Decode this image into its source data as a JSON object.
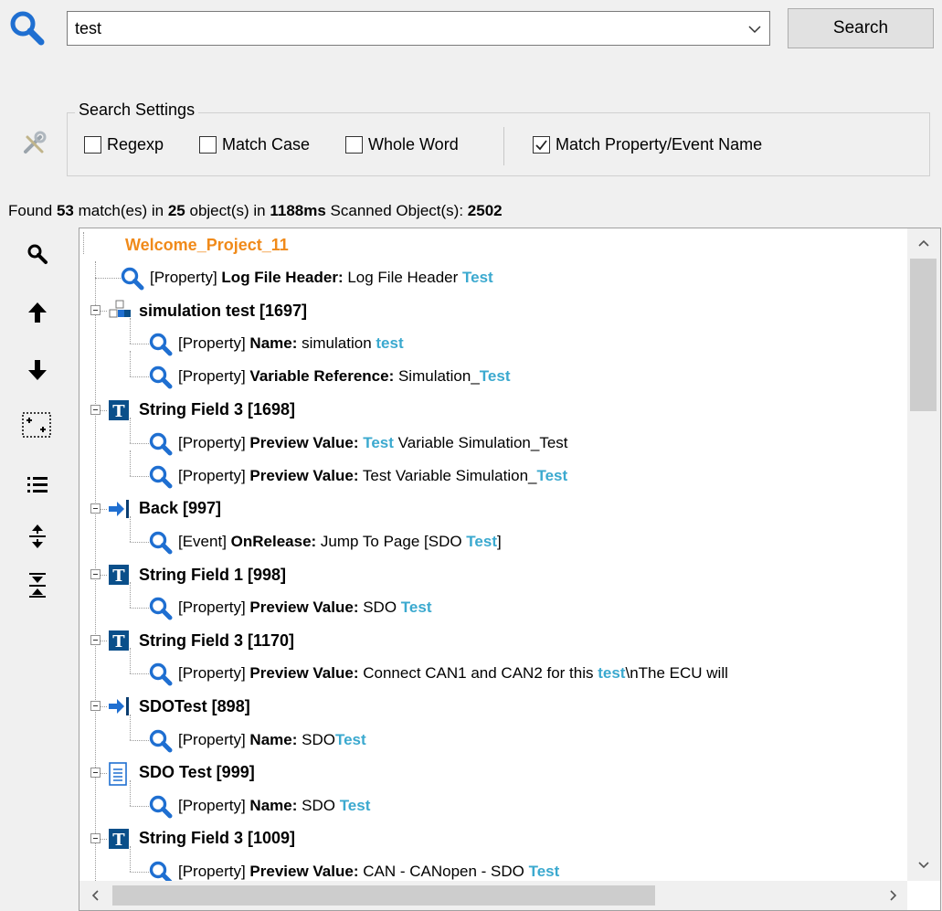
{
  "search": {
    "value": "test",
    "button_label": "Search"
  },
  "settings": {
    "legend": "Search Settings",
    "regexp": {
      "label": "Regexp",
      "checked": false
    },
    "match_case": {
      "label": "Match Case",
      "checked": false
    },
    "whole_word": {
      "label": "Whole Word",
      "checked": false
    },
    "match_property": {
      "label": "Match Property/Event Name",
      "checked": true
    }
  },
  "status": {
    "found_prefix": "Found ",
    "matches": "53",
    "matches_suffix": " match(es) in ",
    "objects": "25",
    "objects_suffix": " object(s) in ",
    "time": "1188ms",
    "scanned_label": " Scanned Object(s): ",
    "scanned": "2502"
  },
  "toolbar": [
    {
      "name": "find-icon"
    },
    {
      "name": "arrow-up-icon"
    },
    {
      "name": "arrow-down-icon"
    },
    {
      "name": "select-area-icon"
    },
    {
      "name": "list-icon"
    },
    {
      "name": "expand-all-icon"
    },
    {
      "name": "collapse-all-icon"
    }
  ],
  "tree": {
    "root": "Welcome_Project_11",
    "colors": {
      "root": "#f08a1a",
      "highlight": "#3ba9cf"
    },
    "rows": [
      {
        "kind": "match",
        "type": "[Property] ",
        "label": "Log File Header:",
        "pre": " Log File Header ",
        "hl": "Test",
        "post": ""
      },
      {
        "kind": "node",
        "icon": "simulation-icon",
        "title": "simulation test [1697]"
      },
      {
        "kind": "match",
        "type": "[Property] ",
        "label": "Name:",
        "pre": " simulation ",
        "hl": "test",
        "post": ""
      },
      {
        "kind": "match",
        "type": "[Property] ",
        "label": "Variable Reference:",
        "pre": " Simulation_",
        "hl": "Test",
        "post": ""
      },
      {
        "kind": "node",
        "icon": "string-field-icon",
        "title": "String Field 3 [1698]"
      },
      {
        "kind": "match",
        "type": "[Property] ",
        "label": "Preview Value:",
        "pre": " ",
        "hl": "Test",
        "post": " Variable Simulation_Test"
      },
      {
        "kind": "match",
        "type": "[Property] ",
        "label": "Preview Value:",
        "pre": " Test Variable Simulation_",
        "hl": "Test",
        "post": ""
      },
      {
        "kind": "node",
        "icon": "jump-icon",
        "title": "Back [997]"
      },
      {
        "kind": "match",
        "type": "[Event] ",
        "label": "OnRelease:",
        "pre": " Jump To Page [SDO ",
        "hl": "Test",
        "post": "]"
      },
      {
        "kind": "node",
        "icon": "string-field-icon",
        "title": "String Field 1 [998]"
      },
      {
        "kind": "match",
        "type": "[Property] ",
        "label": "Preview Value:",
        "pre": " SDO ",
        "hl": "Test",
        "post": ""
      },
      {
        "kind": "node",
        "icon": "string-field-icon",
        "title": "String Field 3 [1170]"
      },
      {
        "kind": "match",
        "type": "[Property] ",
        "label": "Preview Value:",
        "pre": " Connect CAN1 and CAN2 for this ",
        "hl": "test",
        "post": "\\nThe ECU will"
      },
      {
        "kind": "node",
        "icon": "jump-icon",
        "title": "SDOTest [898]"
      },
      {
        "kind": "match",
        "type": "[Property] ",
        "label": "Name:",
        "pre": " SDO",
        "hl": "Test",
        "post": ""
      },
      {
        "kind": "node",
        "icon": "page-icon",
        "title": "SDO Test [999]"
      },
      {
        "kind": "match",
        "type": "[Property] ",
        "label": "Name:",
        "pre": " SDO ",
        "hl": "Test",
        "post": ""
      },
      {
        "kind": "node",
        "icon": "string-field-icon",
        "title": "String Field 3 [1009]"
      },
      {
        "kind": "match",
        "type": "[Property] ",
        "label": "Preview Value:",
        "pre": " CAN - CANopen - SDO ",
        "hl": "Test",
        "post": ""
      }
    ]
  }
}
